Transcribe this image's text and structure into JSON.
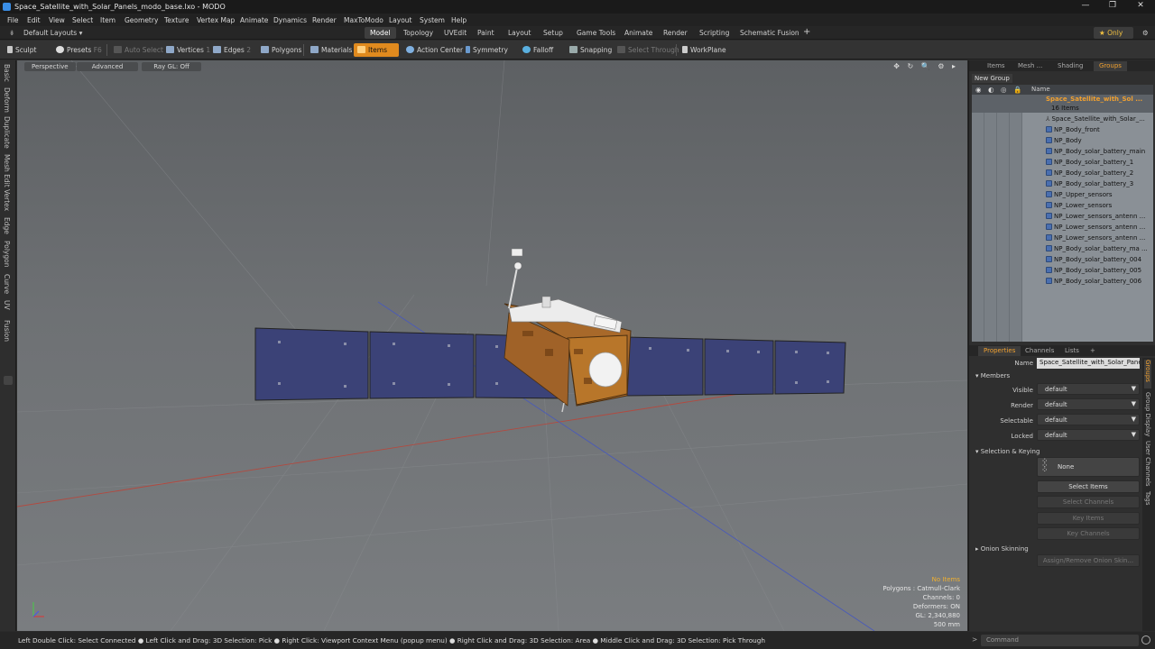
{
  "window": {
    "title": "Space_Satellite_with_Solar_Panels_modo_base.lxo - MODO",
    "minimize": "—",
    "maximize": "❐",
    "close": "✕"
  },
  "menu": [
    "File",
    "Edit",
    "View",
    "Select",
    "Item",
    "Geometry",
    "Texture",
    "Vertex Map",
    "Animate",
    "Dynamics",
    "Render",
    "MaxToModo",
    "Layout",
    "System",
    "Help"
  ],
  "layout": {
    "preset": "Default Layouts ▾",
    "tabs": [
      "Model",
      "Topology",
      "UVEdit",
      "Paint",
      "Layout",
      "Setup",
      "Game Tools",
      "Animate",
      "Render",
      "Scripting",
      "Schematic Fusion"
    ],
    "active_tab": "Model",
    "add": "+",
    "only": "★ Only",
    "gear": "⚙"
  },
  "toolbar": {
    "sculpt": "Sculpt",
    "presets": "Presets",
    "presets_key": "F6",
    "auto_select": "Auto Select",
    "vertices": "Vertices",
    "vertices_count": "1",
    "edges": "Edges",
    "edges_count": "2",
    "polygons": "Polygons",
    "materials": "Materials",
    "items": "Items",
    "action_center": "Action Center",
    "symmetry": "Symmetry",
    "falloff": "Falloff",
    "snapping": "Snapping",
    "select_through": "Select Through",
    "workplane": "WorkPlane"
  },
  "left_tabs": [
    "Basic",
    "Deform",
    "Duplicate",
    "Mesh Edit",
    "Vertex",
    "Edge",
    "Polygon",
    "Curve",
    "UV",
    "Fusion"
  ],
  "viewport": {
    "perspective": "Perspective",
    "advanced": "Advanced",
    "raygl": "Ray GL: Off",
    "icons": "✥ ↻ 🔍 ⚙ ▸",
    "info": {
      "no_items": "No Items",
      "polygons": "Polygons : Catmull-Clark",
      "channels": "Channels: 0",
      "deformers": "Deformers: ON",
      "gl": "GL: 2,340,880",
      "size": "500 mm"
    }
  },
  "items_panel": {
    "tabs": [
      "Items",
      "Mesh ...",
      "Shading",
      "Groups"
    ],
    "active_tab": "Groups",
    "new_group": "New Group",
    "name_header": "Name",
    "group_name": "Space_Satellite_with_Sol ...",
    "group_count": "16 Items",
    "items": [
      "Space_Satellite_with_Solar_...",
      "NP_Body_front",
      "NP_Body",
      "NP_Body_solar_battery_main",
      "NP_Body_solar_battery_1",
      "NP_Body_solar_battery_2",
      "NP_Body_solar_battery_3",
      "NP_Upper_sensors",
      "NP_Lower_sensors",
      "NP_Lower_sensors_antenn ...",
      "NP_Lower_sensors_antenn ...",
      "NP_Lower_sensors_antenn ...",
      "NP_Body_solar_battery_ma ...",
      "NP_Body_solar_battery_004",
      "NP_Body_solar_battery_005",
      "NP_Body_solar_battery_006"
    ]
  },
  "properties_panel": {
    "tabs": [
      "Properties",
      "Channels",
      "Lists"
    ],
    "active_tab": "Properties",
    "add": "+",
    "name_label": "Name",
    "name_value": "Space_Satellite_with_Solar_Panels",
    "members_section": "Members",
    "fields": [
      {
        "label": "Visible",
        "value": "default"
      },
      {
        "label": "Render",
        "value": "default"
      },
      {
        "label": "Selectable",
        "value": "default"
      },
      {
        "label": "Locked",
        "value": "default"
      }
    ],
    "selection_section": "Selection & Keying",
    "none": "None",
    "select_items": "Select Items",
    "select_channels": "Select Channels",
    "key_items": "Key Items",
    "key_channels": "Key Channels",
    "onion_section": "Onion Skinning",
    "assign_onion": "Assign/Remove Onion Skin...",
    "side_tabs": [
      "Groups",
      "Group Display",
      "User Channels",
      "Tags"
    ]
  },
  "status": {
    "text": "Left Double Click: Select Connected ● Left Click and Drag: 3D Selection: Pick ● Right Click: Viewport Context Menu (popup menu) ● Right Click and Drag: 3D Selection: Area ● Middle Click and Drag: 3D Selection: Pick Through"
  },
  "command": {
    "placeholder": "Command"
  },
  "colors": {
    "accent": "#e08a1e",
    "panel": "#2f2f2f",
    "viewport": "#6e7174",
    "solar_panel": "#3b4277",
    "gold_foil": "#b8762a"
  }
}
